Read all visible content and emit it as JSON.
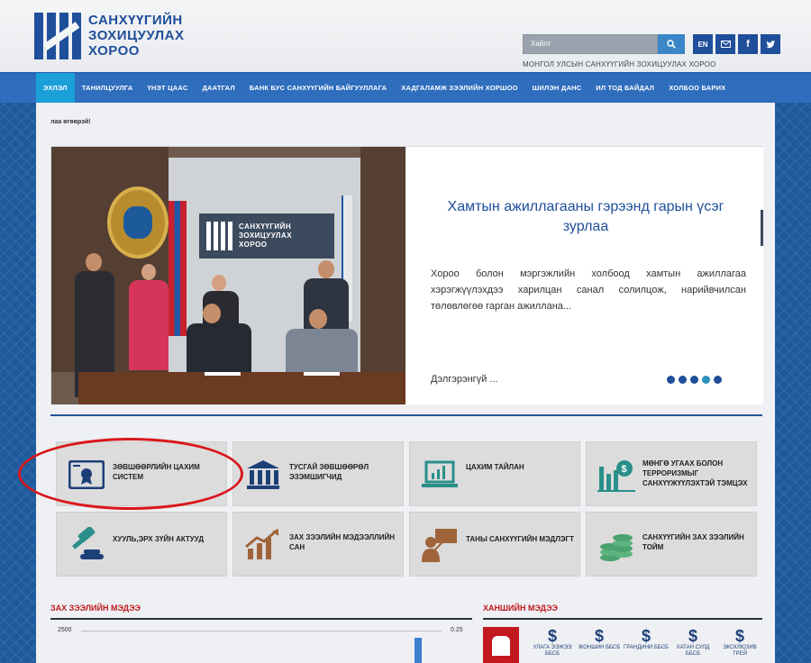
{
  "header": {
    "logo_lines": [
      "САНХҮҮГИЙН",
      "ЗОХИЦУУЛАХ",
      "ХОРОО"
    ],
    "search_placeholder": "Хайлт",
    "lang_label": "EN",
    "subtitle": "МОНГОЛ УЛСЫН САНХҮҮГИЙН ЗОХИЦУУЛАХ ХОРОО"
  },
  "nav": {
    "items": [
      {
        "label": "ЭХЛЭЛ",
        "active": true
      },
      {
        "label": "ТАНИЛЦУУЛГА"
      },
      {
        "label": "ҮНЭТ ЦААС"
      },
      {
        "label": "ДААТГАЛ"
      },
      {
        "label": "БАНК БУС САНХҮҮГИЙН БАЙГУУЛЛАГА"
      },
      {
        "label": "ХАДГАЛАМЖ ЗЭЭЛИЙН ХОРШОО"
      },
      {
        "label": "ШИЛЭН ДАНС"
      },
      {
        "label": "ИЛ ТОД БАЙДАЛ"
      },
      {
        "label": "ХОЛБОО БАРИХ"
      }
    ]
  },
  "main": {
    "greeting": "лаа өгөөрэй!",
    "slider": {
      "banner_text": [
        "САНХҮҮГИЙН",
        "ЗОХИЦУУЛАХ",
        "ХОРОО"
      ],
      "title": "Хамтын ажиллагааны гэрээнд гарын үсэг зурлаа",
      "body": "Хороо болон мэргэжлийн холбоод хамтын ажиллагаа хэрэгжүүлэхдээ харилцан санал солилцож, нарийвчилсан төлөвлөгөө гарган ажиллана...",
      "more": "Дэлгэрэнгүй ...",
      "dots": 5,
      "active_dot": 3
    },
    "tiles": [
      {
        "label": "ЗӨВШӨӨРЛИЙН ЦАХИМ СИСТЕМ",
        "icon": "certificate-icon"
      },
      {
        "label": "ТУСГАЙ ЗӨВШӨӨРӨЛ ЭЗЭМШИГЧИД",
        "icon": "bank-building-icon"
      },
      {
        "label": "ЦАХИМ ТАЙЛАН",
        "icon": "laptop-chart-icon"
      },
      {
        "label": "МӨНГӨ УГААХ БОЛОН ТЕРРОРИЗМЫГ САНХҮҮЖҮҮЛЭХТЭЙ ТЭМЦЭХ",
        "icon": "money-chart-icon"
      },
      {
        "label": "ХУУЛЬ,ЭРХ ЗҮЙН АКТУУД",
        "icon": "gavel-icon"
      },
      {
        "label": "ЗАХ ЗЭЭЛИЙН МЭДЭЭЛЛИЙН САН",
        "icon": "growth-chart-icon"
      },
      {
        "label": "ТАНЫ САНХҮҮГИЙН МЭДЛЭГТ",
        "icon": "presenter-icon"
      },
      {
        "label": "САНХҮҮГИЙН ЗАХ ЗЭЭЛИЙН ТОЙМ",
        "icon": "coins-stack-icon"
      }
    ],
    "market": {
      "title": "ЗАХ ЗЭЭЛИЙН МЭДЭЭ",
      "y_left": "2500",
      "y_right": "0.25"
    },
    "rates": {
      "title": "ХАНШИЙН МЭДЭЭ",
      "items": [
        {
          "name": "УЛАГА ЭЭЖЭЭ ББСБ"
        },
        {
          "name": "ЖОНШИН ББСБ"
        },
        {
          "name": "ГРАНДИНИ ББСБ"
        },
        {
          "name": "ХАТАН СУЛД ББСБ"
        },
        {
          "name": "ЭКСКЛЮЗИВ ТРЕЙ"
        }
      ]
    }
  },
  "colors": {
    "brand_blue": "#1f4e9a",
    "nav_blue": "#2f6dbd",
    "nav_active": "#1b9fd8",
    "highlight_red": "#d9161b",
    "tile_icon": "#1d3f78",
    "tile_icon_alt": "#2a8f8a"
  }
}
